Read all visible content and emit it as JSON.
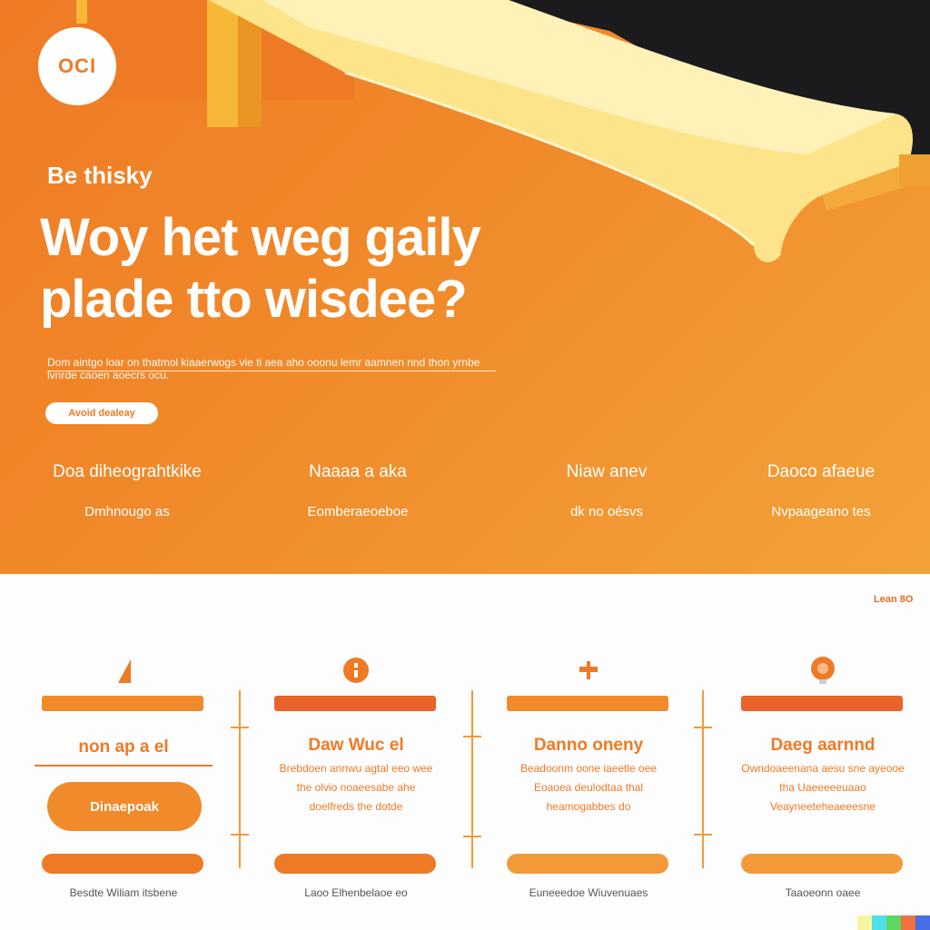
{
  "brand": {
    "logo_text": "OCI"
  },
  "hero": {
    "eyebrow": "Be thisky",
    "headline": "Woy het weg gaily plade tto wisdee?",
    "lede": "Dom aintgo loar on thatmol kiaaerwogs vie ti aea aho ooonu lemr aamnen nnd thon yrnbe lvnrde caoen aoecrs ocu.",
    "cta_label": "Avoid dealeay"
  },
  "stats": [
    {
      "title": "Doa diheograhtkike",
      "subtitle": "Dmhnougo as"
    },
    {
      "title": "Naaaa a aka",
      "subtitle": "Eomberaeoeboe"
    },
    {
      "title": "Niaw anev",
      "subtitle": "dk no oésvs"
    },
    {
      "title": "Daoco afaeue",
      "subtitle": "Nvpaageano tes"
    }
  ],
  "section": {
    "more_link": "Lean 8O"
  },
  "cards": [
    {
      "title": "non ap a el",
      "button_label": "Dinaepoak",
      "bottom_label": "",
      "footer": "Besdte Wiliam itsbene"
    },
    {
      "title": "Daw Wuc el",
      "body": "Brebdoen annwu agtal eeo wee the olvio noaeesabe ahe doelfreds the dotde",
      "bottom_label": "",
      "footer": "Laoo Elhenbelaoe eo"
    },
    {
      "title": "Danno oneny",
      "body": "Beadoonm oone iaeetle oee Eoaoea deulodtaa thal heamogabbes do",
      "bottom_label": "",
      "footer": "Euneeedoe Wiuvenuaes"
    },
    {
      "title": "Daeg aarnnd",
      "body": "Owndoaeenana aesu sne ayeooe tha Uaeeeeeuaao Veayneeteheaeeesne",
      "bottom_label": "",
      "footer": "Taaoeonn oaee"
    }
  ],
  "colors": {
    "accent": "#ef7a25",
    "accent_light": "#f3a23a",
    "dark": "#1b1b1d",
    "slide_yellow": "#fde48a"
  }
}
